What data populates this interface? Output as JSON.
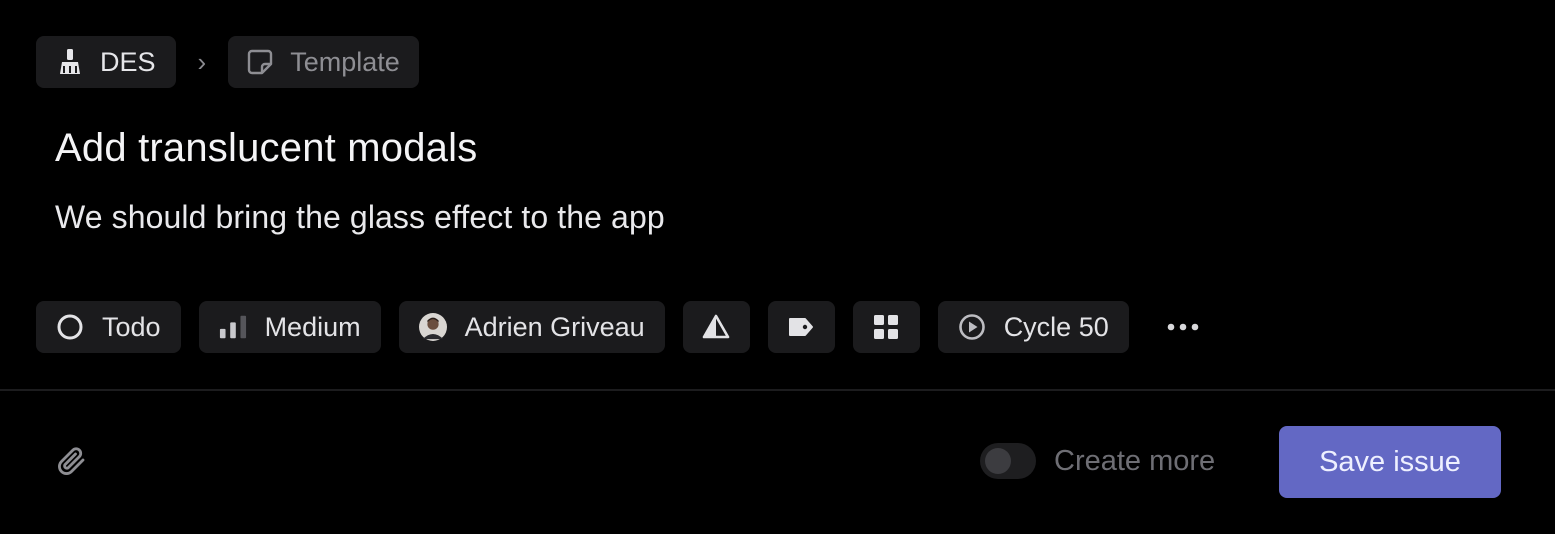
{
  "breadcrumb": {
    "team": {
      "label": "DES",
      "icon": "broom-icon"
    },
    "separator": "›",
    "template": {
      "label": "Template",
      "icon": "sticky-note-icon"
    }
  },
  "issue": {
    "title": "Add translucent modals",
    "description": "We should bring the glass effect to the app"
  },
  "properties": {
    "status": {
      "label": "Todo",
      "icon": "circle-status-icon"
    },
    "priority": {
      "label": "Medium",
      "icon": "priority-bars-icon"
    },
    "assignee": {
      "label": "Adrien Griveau",
      "icon": "avatar"
    },
    "estimate": {
      "icon": "triangle-estimate-icon"
    },
    "labels": {
      "icon": "tag-icon"
    },
    "project": {
      "icon": "grid-icon"
    },
    "cycle": {
      "label": "Cycle 50",
      "icon": "cycle-icon"
    },
    "more": {
      "icon": "more-icon"
    }
  },
  "footer": {
    "attach_icon": "paperclip-icon",
    "create_more_label": "Create more",
    "create_more_enabled": false,
    "save_label": "Save issue"
  },
  "colors": {
    "background": "#000000",
    "chip": "#1b1b1d",
    "accent": "#6368c4"
  }
}
